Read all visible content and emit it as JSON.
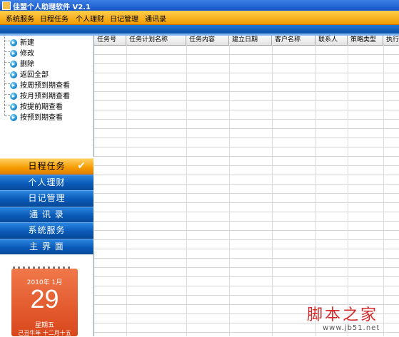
{
  "window": {
    "title": "佳盟个人助理软件 V2.1"
  },
  "menu": [
    {
      "label": "系统服务"
    },
    {
      "label": "日程任务"
    },
    {
      "label": "个人理财"
    },
    {
      "label": "日记管理"
    },
    {
      "label": "通讯录"
    }
  ],
  "tree": [
    {
      "label": "新建"
    },
    {
      "label": "修改"
    },
    {
      "label": "删除"
    },
    {
      "label": "返回全部"
    },
    {
      "label": "按周预到期查看"
    },
    {
      "label": "按月预到期查看"
    },
    {
      "label": "按提前期查看"
    },
    {
      "label": "按预到期查看"
    }
  ],
  "nav": [
    {
      "label": "日程任务",
      "active": true
    },
    {
      "label": "个人理财"
    },
    {
      "label": "日记管理"
    },
    {
      "label": "通 讯 录"
    },
    {
      "label": "系统服务"
    },
    {
      "label": "主 界 面"
    }
  ],
  "calendar": {
    "year_month": "2010年 1月",
    "day": "29",
    "weekday": "星期五",
    "lunar": "己丑牛年 十二月十五"
  },
  "grid": {
    "columns": [
      "任务号",
      "任务计划名称",
      "任务内容",
      "建立日期",
      "客户名称",
      "联系人",
      "策略类型",
      "执行"
    ]
  },
  "watermark": {
    "text": "脚本之家",
    "url": "www.jb51.net"
  },
  "colors": {
    "menubar": "#f7b21c",
    "nav_blue": "#0b5ab8",
    "nav_active": "#f49a00",
    "calendar": "#d9471c"
  }
}
